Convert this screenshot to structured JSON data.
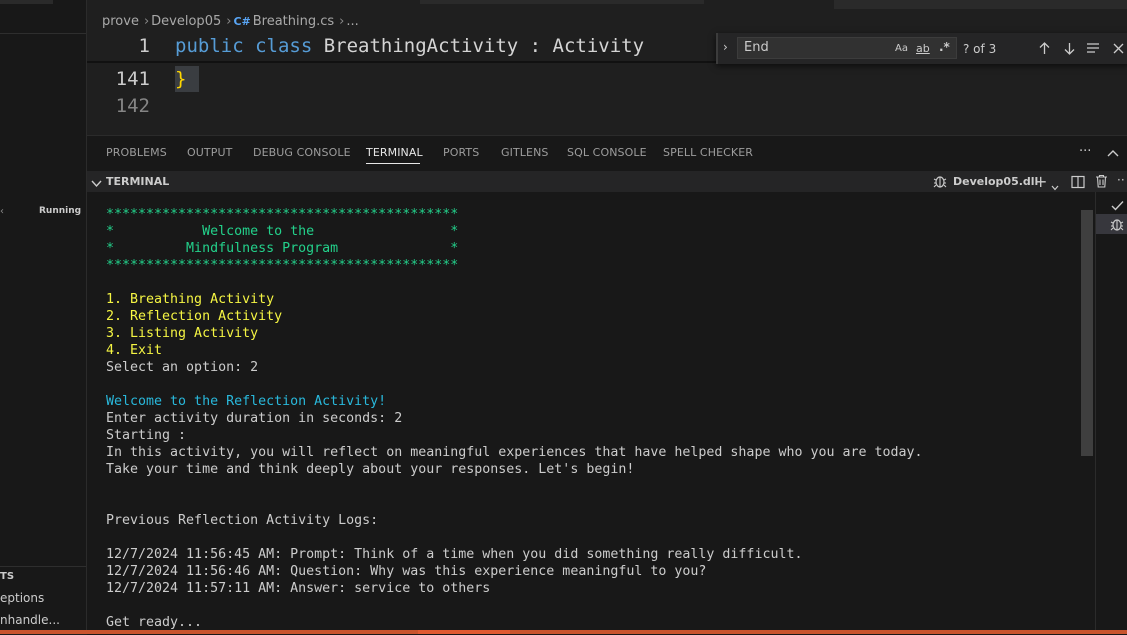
{
  "sidebar": {
    "running_label": "Running",
    "section_label": "TS",
    "items": [
      "eptions",
      "nhandle..."
    ]
  },
  "breadcrumb": {
    "items": [
      "prove",
      "Develop05",
      "Breathing.cs",
      "..."
    ],
    "file_badge": "C#"
  },
  "editor": {
    "lines": [
      {
        "num": "1",
        "keyword1": "public",
        "keyword2": "class",
        "rest": " BreathingActivity : Activity"
      },
      {
        "num": "141",
        "text": "}"
      },
      {
        "num": "142",
        "text": ""
      }
    ]
  },
  "find": {
    "value": "End",
    "match_case": "Aa",
    "whole_word": "ab",
    "regex": ".*",
    "result": "? of 3"
  },
  "panel": {
    "tabs": [
      "PROBLEMS",
      "OUTPUT",
      "DEBUG CONSOLE",
      "TERMINAL",
      "PORTS",
      "GITLENS",
      "SQL CONSOLE",
      "SPELL CHECKER"
    ],
    "active_tab": "TERMINAL",
    "more": "···"
  },
  "terminal": {
    "header": "TERMINAL",
    "instance": "Develop05.dll",
    "lines": [
      {
        "text": "********************************************",
        "color": "green"
      },
      {
        "text": "*           Welcome to the                 *",
        "color": "green"
      },
      {
        "text": "*         Mindfulness Program              *",
        "color": "green"
      },
      {
        "text": "********************************************",
        "color": "green"
      },
      {
        "text": "",
        "color": "white"
      },
      {
        "text": "1. Breathing Activity",
        "color": "yellow"
      },
      {
        "text": "2. Reflection Activity",
        "color": "yellow"
      },
      {
        "text": "3. Listing Activity",
        "color": "yellow"
      },
      {
        "text": "4. Exit",
        "color": "yellow"
      },
      {
        "text": "Select an option: 2",
        "color": "white"
      },
      {
        "text": "",
        "color": "white"
      },
      {
        "text": "Welcome to the Reflection Activity!",
        "color": "cyan"
      },
      {
        "text": "Enter activity duration in seconds: 2",
        "color": "white"
      },
      {
        "text": "Starting :",
        "color": "white"
      },
      {
        "text": "In this activity, you will reflect on meaningful experiences that have helped shape who you are today.",
        "color": "white"
      },
      {
        "text": "Take your time and think deeply about your responses. Let's begin!",
        "color": "white"
      },
      {
        "text": "",
        "color": "white"
      },
      {
        "text": "",
        "color": "white"
      },
      {
        "text": "Previous Reflection Activity Logs:",
        "color": "white"
      },
      {
        "text": "",
        "color": "white"
      },
      {
        "text": "12/7/2024 11:56:45 AM: Prompt: Think of a time when you did something really difficult.",
        "color": "white"
      },
      {
        "text": "12/7/2024 11:56:46 AM: Question: Why was this experience meaningful to you?",
        "color": "white"
      },
      {
        "text": "12/7/2024 11:57:11 AM: Answer: service to others",
        "color": "white"
      },
      {
        "text": "",
        "color": "white"
      },
      {
        "text": "Get ready...",
        "color": "white"
      }
    ]
  },
  "colors": {
    "green": "#23d18b",
    "yellow": "#f5f543",
    "cyan": "#29b8db",
    "status_bar": "#c9542e"
  }
}
